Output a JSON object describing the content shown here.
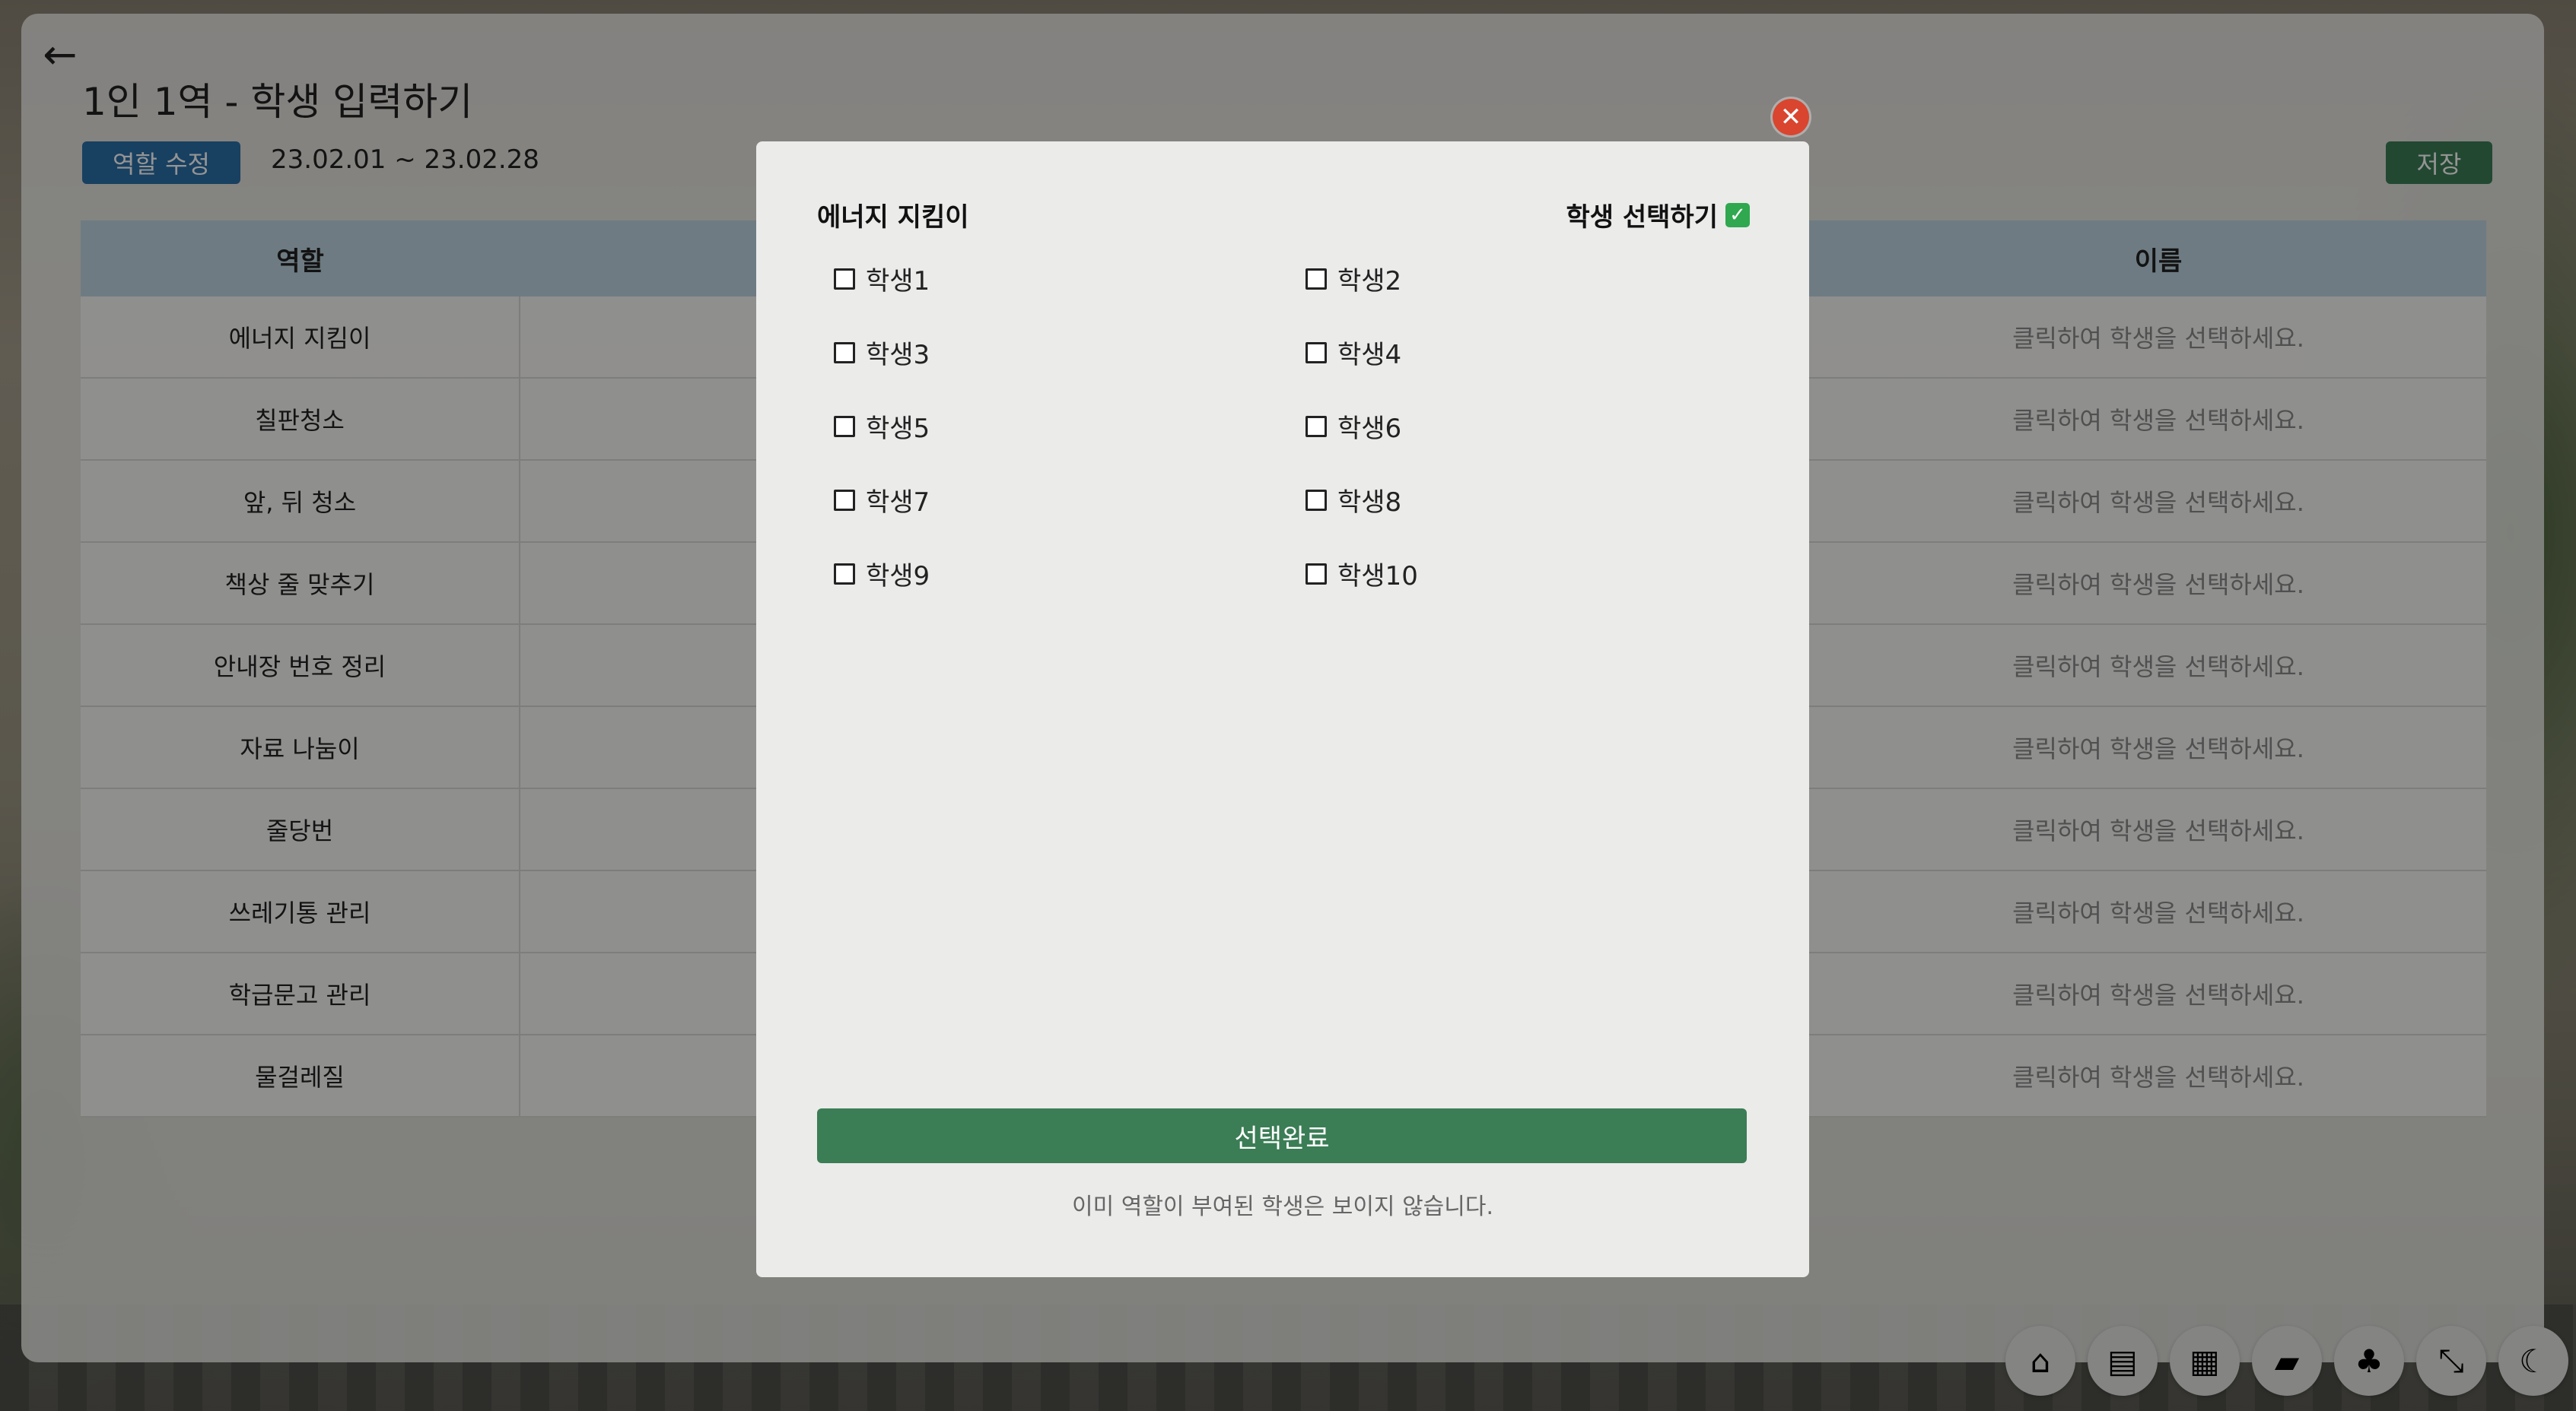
{
  "page": {
    "title": "1인 1역 - 학생 입력하기",
    "edit_label": "역할 수정",
    "period": "23.02.01 ~ 23.02.28",
    "save_label": "저장"
  },
  "table": {
    "headers": [
      "역할",
      "이름"
    ],
    "rows": [
      {
        "role": "에너지 지킴이",
        "name": "클릭하여 학생을 선택하세요."
      },
      {
        "role": "칠판청소",
        "name": "클릭하여 학생을 선택하세요."
      },
      {
        "role": "앞, 뒤 청소",
        "name": "클릭하여 학생을 선택하세요."
      },
      {
        "role": "책상 줄 맞추기",
        "name": "클릭하여 학생을 선택하세요."
      },
      {
        "role": "안내장 번호 정리",
        "name": "클릭하여 학생을 선택하세요."
      },
      {
        "role": "자료 나눔이",
        "name": "클릭하여 학생을 선택하세요."
      },
      {
        "role": "줄당번",
        "name": "클릭하여 학생을 선택하세요."
      },
      {
        "role": "쓰레기통 관리",
        "name": "클릭하여 학생을 선택하세요."
      },
      {
        "role": "학급문고 관리",
        "name": "클릭하여 학생을 선택하세요."
      },
      {
        "role": "물걸레질",
        "name": "클릭하여 학생을 선택하세요."
      }
    ]
  },
  "modal": {
    "role": "에너지 지킴이",
    "heading": "학생 선택하기",
    "heading_emoji": "✅",
    "students": [
      "학생1",
      "학생2",
      "학생3",
      "학생4",
      "학생5",
      "학생6",
      "학생7",
      "학생8",
      "학생9",
      "학생10"
    ],
    "done_label": "선택완료",
    "note": "이미 역할이 부여된 학생은 보이지 않습니다."
  },
  "dock": [
    {
      "name": "home-icon",
      "glyph": "⌂"
    },
    {
      "name": "notebook-icon",
      "glyph": "▤"
    },
    {
      "name": "calendar-icon",
      "glyph": "▦"
    },
    {
      "name": "folder-icon",
      "glyph": "▰"
    },
    {
      "name": "bell-icon",
      "glyph": "♣"
    },
    {
      "name": "collapse-icon",
      "glyph": "⤡"
    },
    {
      "name": "moon-icon",
      "glyph": "☾"
    }
  ],
  "colors": {
    "accent_green": "#3b7d55",
    "accent_blue": "#2a6ea8",
    "close_red": "#d9452f",
    "table_header": "#bdd4e0"
  }
}
